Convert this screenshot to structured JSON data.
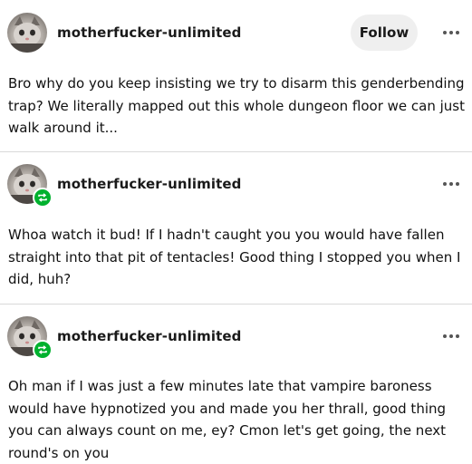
{
  "posts": [
    {
      "username": "motherfucker-unlimited",
      "follow_label": "Follow",
      "text": "Bro why do you keep insisting we try to disarm this genderbending trap? We literally mapped out this whole dungeon floor we can just walk around it...",
      "reblogged": false
    },
    {
      "username": "motherfucker-unlimited",
      "text": "Whoa watch it bud! If I hadn't caught you you would have fallen straight into that pit of tentacles! Good thing I stopped you when I did, huh?",
      "reblogged": true
    },
    {
      "username": "motherfucker-unlimited",
      "text": "Oh man if I was just a few minutes late that vampire baroness would have hypnotized you and made you her thrall, good thing you can always count on me, ey? Cmon let's get going, the next round's on you",
      "reblogged": true
    }
  ],
  "colors": {
    "reblog_badge": "#00b12e",
    "follow_button_bg": "#efefef",
    "divider": "#d9d9d9"
  },
  "icons": {
    "more": "more-options-icon",
    "reblog": "reblog-icon"
  }
}
